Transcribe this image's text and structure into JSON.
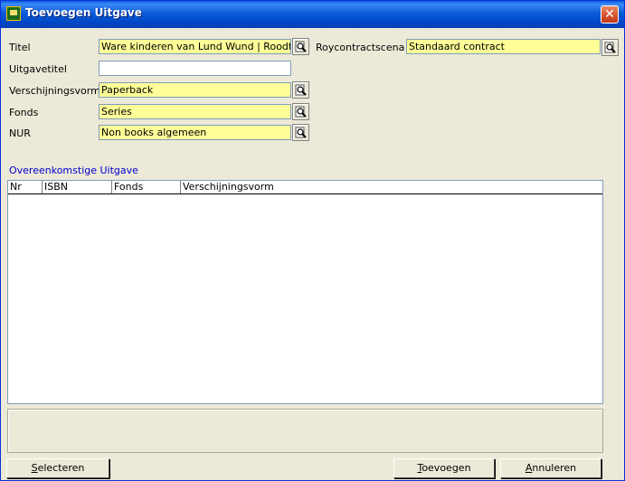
{
  "window": {
    "title": "Toevoegen Uitgave",
    "close_label": "✕"
  },
  "form": {
    "titel_label": "Titel",
    "titel_value": "Ware kinderen van Lund Wund | Roodt, N.,",
    "uitgavetitel_label": "Uitgavetitel",
    "uitgavetitel_value": "",
    "verschijningsvorm_label": "Verschijningsvorm",
    "verschijningsvorm_value": "Paperback",
    "fonds_label": "Fonds",
    "fonds_value": "Series",
    "nur_label": "NUR",
    "nur_value": "Non books algemeen",
    "roycontract_label": "Roycontractscenario",
    "roycontract_value": "Standaard contract"
  },
  "section": {
    "title": "Overeenkomstige Uitgave"
  },
  "grid": {
    "columns": [
      "Nr",
      "ISBN",
      "Fonds",
      "Verschijningsvorm"
    ],
    "rows": []
  },
  "buttons": {
    "selecteren_first": "S",
    "selecteren_rest": "electeren",
    "toevoegen_first": "T",
    "toevoegen_rest": "oevoegen",
    "annuleren_first": "A",
    "annuleren_rest": "nnuleren"
  },
  "icons": {
    "lookup": "magnifier-lookup-icon",
    "app": "app-icon"
  }
}
